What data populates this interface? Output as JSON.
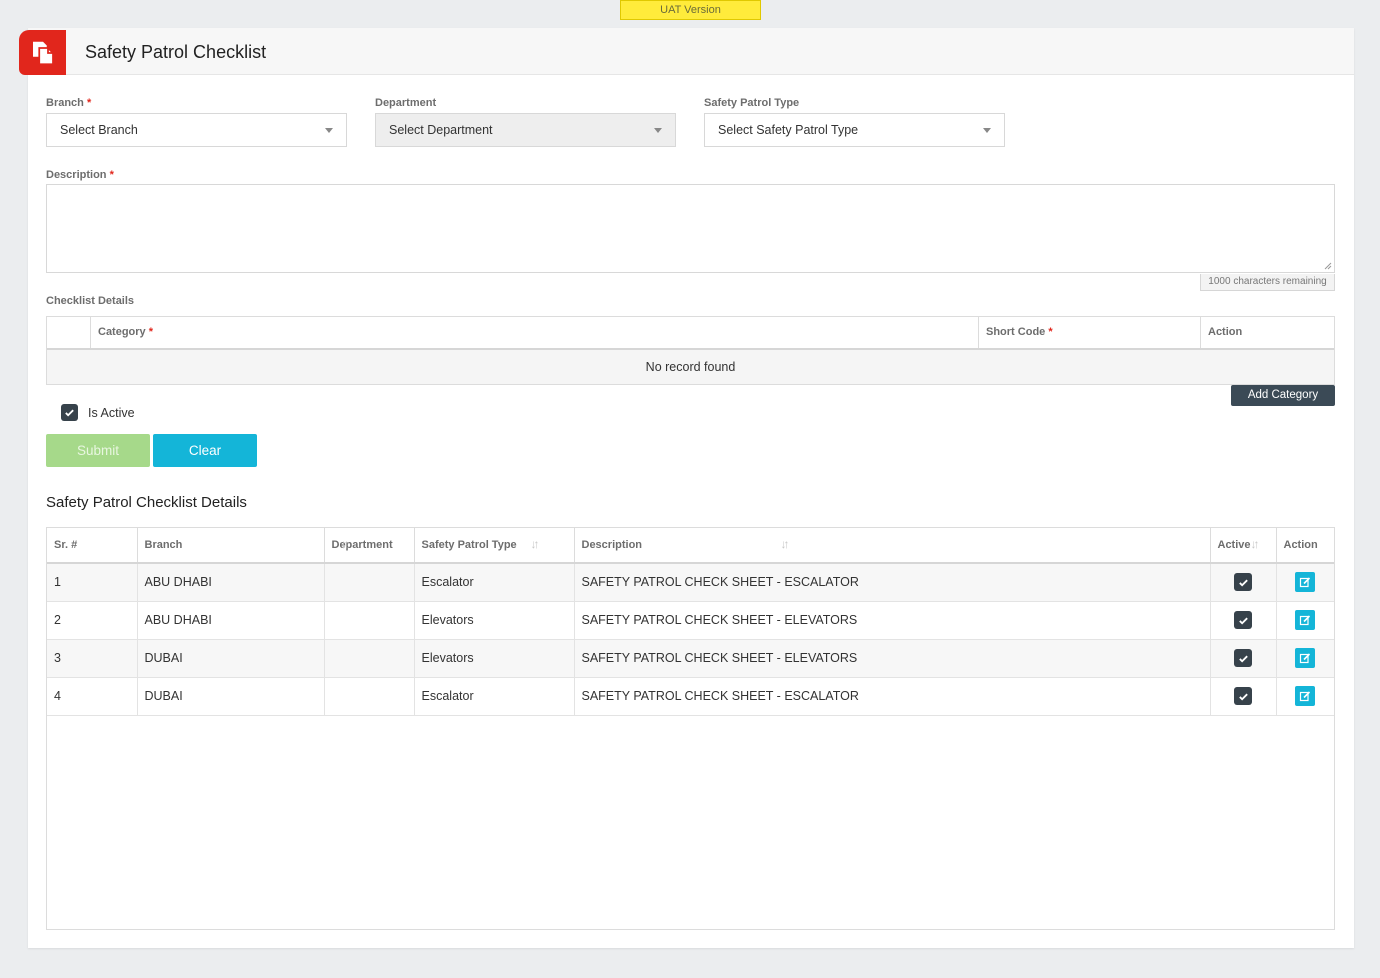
{
  "banner": {
    "text": "UAT Version"
  },
  "header": {
    "title": "Safety Patrol Checklist",
    "logo_icon": "document-copy-icon",
    "logo_color": "#e1261c"
  },
  "form": {
    "branch": {
      "label": "Branch",
      "value": "Select Branch"
    },
    "department": {
      "label": "Department",
      "value": "Select Department"
    },
    "patrol_type": {
      "label": "Safety Patrol Type",
      "value": "Select Safety Patrol Type"
    },
    "description": {
      "label": "Description",
      "value": "",
      "counter": "1000 characters remaining"
    },
    "required_mark": "*"
  },
  "checklist": {
    "title": "Checklist Details",
    "columns": {
      "category": "Category",
      "short_code": "Short Code",
      "action": "Action"
    },
    "empty_text": "No record found",
    "add_label": "Add Category"
  },
  "is_active": {
    "label": "Is Active",
    "checked": true
  },
  "buttons": {
    "submit": "Submit",
    "clear": "Clear"
  },
  "details": {
    "title": "Safety Patrol Checklist Details",
    "columns": {
      "sr": "Sr. #",
      "branch": "Branch",
      "department": "Department",
      "type": "Safety Patrol Type",
      "description": "Description",
      "active": "Active",
      "action": "Action"
    },
    "rows": [
      {
        "sr": "1",
        "branch": "ABU DHABI",
        "department": "",
        "type": "Escalator",
        "description": "SAFETY PATROL CHECK SHEET - ESCALATOR",
        "active": true
      },
      {
        "sr": "2",
        "branch": "ABU DHABI",
        "department": "",
        "type": "Elevators",
        "description": "SAFETY PATROL CHECK SHEET - ELEVATORS",
        "active": true
      },
      {
        "sr": "3",
        "branch": "DUBAI",
        "department": "",
        "type": "Elevators",
        "description": "SAFETY PATROL CHECK SHEET - ELEVATORS",
        "active": true
      },
      {
        "sr": "4",
        "branch": "DUBAI",
        "department": "",
        "type": "Escalator",
        "description": "SAFETY PATROL CHECK SHEET - ESCALATOR",
        "active": true
      }
    ]
  },
  "colors": {
    "accent": "#14b5d8",
    "dark": "#37424b",
    "submit_disabled": "#a6d98a",
    "banner": "#ffeb3b"
  }
}
